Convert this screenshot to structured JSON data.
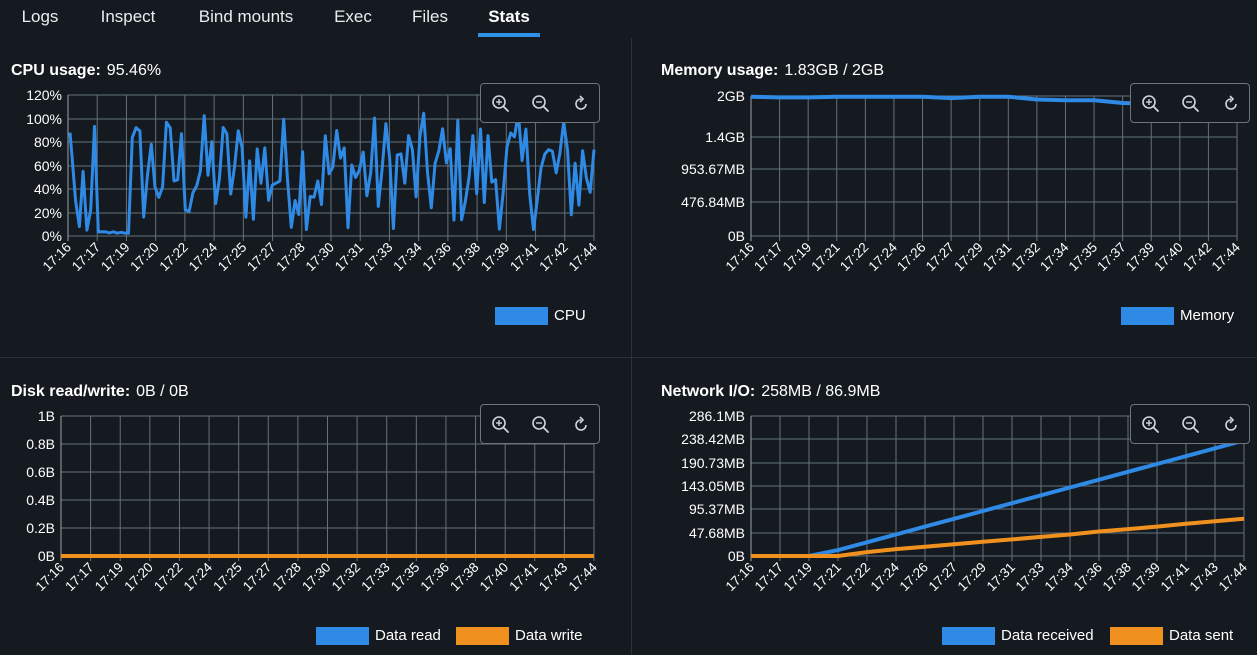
{
  "tabs": [
    {
      "label": "Logs",
      "active": false
    },
    {
      "label": "Inspect",
      "active": false
    },
    {
      "label": "Bind mounts",
      "active": false
    },
    {
      "label": "Exec",
      "active": false
    },
    {
      "label": "Files",
      "active": false
    },
    {
      "label": "Stats",
      "active": true
    }
  ],
  "colors": {
    "accent": "#2f92e8",
    "series_blue": "#2f8ae5",
    "series_orange": "#f0911f",
    "grid": "#64707c",
    "background": "#141a1f"
  },
  "toolbar_icons": [
    "zoom-in-icon",
    "zoom-out-icon",
    "reset-icon"
  ],
  "charts": {
    "cpu": {
      "title": "CPU usage:",
      "value": "95.46%"
    },
    "memory": {
      "title": "Memory usage:",
      "value": "1.83GB / 2GB"
    },
    "disk": {
      "title": "Disk read/write:",
      "value": "0B / 0B"
    },
    "network": {
      "title": "Network I/O:",
      "value": "258MB / 86.9MB"
    }
  },
  "chart_data": [
    {
      "id": "cpu",
      "type": "line",
      "title": "CPU usage:",
      "x": [
        "17:16",
        "17:17",
        "17:19",
        "17:20",
        "17:22",
        "17:24",
        "17:25",
        "17:27",
        "17:28",
        "17:30",
        "17:31",
        "17:33",
        "17:34",
        "17:36",
        "17:38",
        "17:39",
        "17:41",
        "17:42",
        "17:44"
      ],
      "xlabel": "",
      "ylabel": "",
      "ylim": [
        0,
        120
      ],
      "yticks": [
        "0%",
        "20%",
        "40%",
        "60%",
        "80%",
        "100%",
        "120%"
      ],
      "grid": true,
      "legend": "bottom-right",
      "series": [
        {
          "name": "CPU",
          "color": "#2f8ae5",
          "unit": "%",
          "values": [
            90,
            3,
            3,
            58,
            92,
            68,
            52,
            62,
            82,
            60,
            48,
            70,
            74,
            48,
            85,
            78,
            58,
            55,
            92
          ]
        }
      ]
    },
    {
      "id": "memory",
      "type": "line",
      "title": "Memory usage:",
      "x": [
        "17:16",
        "17:17",
        "17:19",
        "17:21",
        "17:22",
        "17:24",
        "17:26",
        "17:27",
        "17:29",
        "17:31",
        "17:32",
        "17:34",
        "17:35",
        "17:37",
        "17:39",
        "17:40",
        "17:42",
        "17:44"
      ],
      "xlabel": "",
      "ylabel": "",
      "ylim": [
        0,
        2
      ],
      "yticks": [
        "0B",
        "476.84MB",
        "953.67MB",
        "1.4GB",
        "2GB"
      ],
      "grid": true,
      "legend": "bottom-right",
      "series": [
        {
          "name": "Memory",
          "color": "#2f8ae5",
          "unit": "GB",
          "values": [
            1.99,
            1.98,
            1.98,
            1.99,
            1.99,
            1.99,
            1.99,
            1.97,
            1.99,
            1.99,
            1.95,
            1.94,
            1.94,
            1.9,
            1.89,
            1.89,
            1.89,
            1.89
          ]
        }
      ]
    },
    {
      "id": "disk",
      "type": "line",
      "title": "Disk read/write:",
      "x": [
        "17:16",
        "17:17",
        "17:19",
        "17:20",
        "17:22",
        "17:24",
        "17:25",
        "17:27",
        "17:28",
        "17:30",
        "17:32",
        "17:33",
        "17:35",
        "17:36",
        "17:38",
        "17:40",
        "17:41",
        "17:43",
        "17:44"
      ],
      "xlabel": "",
      "ylabel": "",
      "ylim": [
        0,
        1
      ],
      "yticks": [
        "0B",
        "0.2B",
        "0.4B",
        "0.6B",
        "0.8B",
        "1B"
      ],
      "grid": true,
      "legend": "bottom-right",
      "series": [
        {
          "name": "Data read",
          "color": "#2f8ae5",
          "unit": "B",
          "values": [
            0,
            0,
            0,
            0,
            0,
            0,
            0,
            0,
            0,
            0,
            0,
            0,
            0,
            0,
            0,
            0,
            0,
            0,
            0
          ]
        },
        {
          "name": "Data write",
          "color": "#f0911f",
          "unit": "B",
          "values": [
            0,
            0,
            0,
            0,
            0,
            0,
            0,
            0,
            0,
            0,
            0,
            0,
            0,
            0,
            0,
            0,
            0,
            0,
            0
          ]
        }
      ]
    },
    {
      "id": "network",
      "type": "line",
      "title": "Network I/O:",
      "x": [
        "17:16",
        "17:17",
        "17:19",
        "17:21",
        "17:22",
        "17:24",
        "17:26",
        "17:27",
        "17:29",
        "17:31",
        "17:33",
        "17:34",
        "17:36",
        "17:38",
        "17:39",
        "17:41",
        "17:43",
        "17:44"
      ],
      "xlabel": "",
      "ylabel": "",
      "ylim": [
        0,
        286.1
      ],
      "yticks": [
        "0B",
        "47.68MB",
        "95.37MB",
        "143.05MB",
        "190.73MB",
        "238.42MB",
        "286.1MB"
      ],
      "grid": true,
      "legend": "bottom-right",
      "series": [
        {
          "name": "Data received",
          "color": "#2f8ae5",
          "unit": "MB",
          "values": [
            0,
            0,
            0,
            12,
            28,
            44,
            60,
            76,
            92,
            108,
            124,
            140,
            156,
            172,
            188,
            204,
            220,
            236
          ]
        },
        {
          "name": "Data sent",
          "color": "#f0911f",
          "unit": "MB",
          "values": [
            0,
            0,
            0,
            0,
            8,
            14,
            19,
            24,
            29,
            34,
            39,
            44,
            50,
            55,
            60,
            66,
            71,
            76
          ]
        }
      ]
    }
  ]
}
